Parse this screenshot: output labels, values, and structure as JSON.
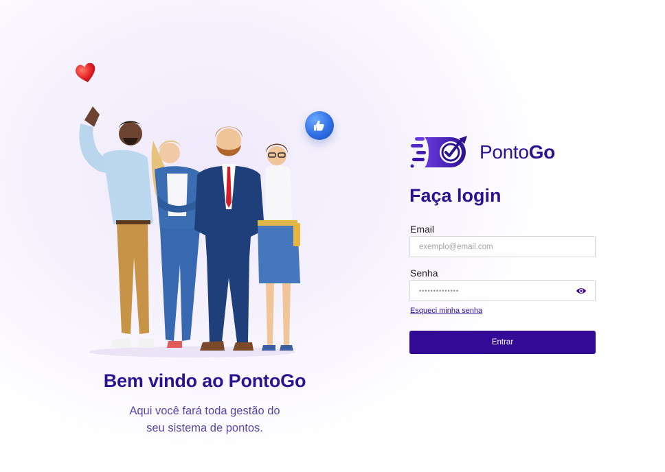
{
  "brand": {
    "name_light": "Ponto",
    "name_bold": "Go",
    "accent_color": "#330a96",
    "title_color": "#2c1191"
  },
  "welcome": {
    "title": "Bem vindo ao PontoGo",
    "subtitle_line1": "Aqui você fará toda gestão do",
    "subtitle_line2": "seu sistema de pontos."
  },
  "login": {
    "title": "Faça login",
    "email_label": "Email",
    "email_placeholder": "exemplo@email.com",
    "password_label": "Senha",
    "password_value": "••••••••••••••",
    "show_password_icon": "eye-icon",
    "forgot_link": "Esqueci minha senha",
    "submit_label": "Entrar"
  },
  "illustration": {
    "description_icons": [
      "heart-icon",
      "like-bubble-icon"
    ]
  }
}
